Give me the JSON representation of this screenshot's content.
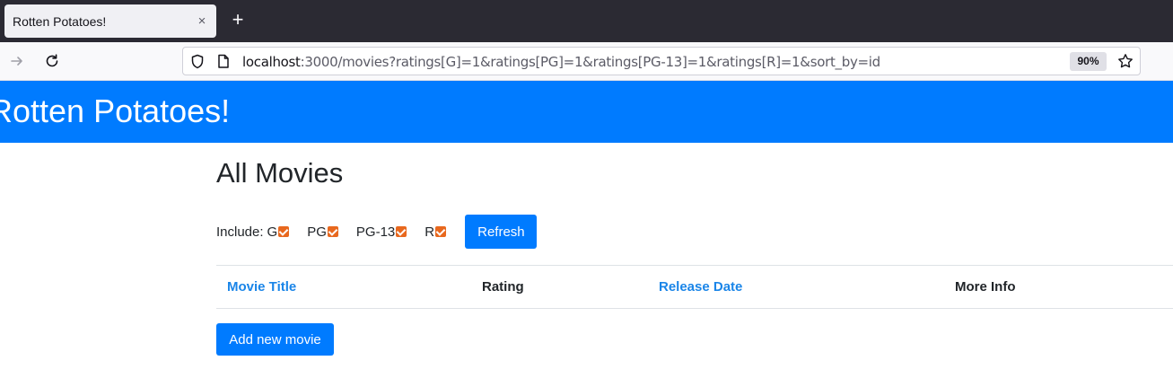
{
  "browser": {
    "tab_title": "Rotten Potatoes!",
    "tab_close": "×",
    "new_tab": "+",
    "url_host": "localhost",
    "url_rest": ":3000/movies?ratings[G]=1&ratings[PG]=1&ratings[PG-13]=1&ratings[R]=1&sort_by=id",
    "zoom": "90%"
  },
  "header": {
    "title": "Rotten Potatoes!"
  },
  "page": {
    "heading": "All Movies",
    "include_label": "Include:",
    "ratings": [
      {
        "label": "G",
        "checked": true
      },
      {
        "label": "PG",
        "checked": true
      },
      {
        "label": "PG-13",
        "checked": true
      },
      {
        "label": "R",
        "checked": true
      }
    ],
    "refresh_label": "Refresh",
    "table": {
      "columns": [
        {
          "label": "Movie Title",
          "link": true
        },
        {
          "label": "Rating",
          "link": false
        },
        {
          "label": "Release Date",
          "link": true
        },
        {
          "label": "More Info",
          "link": false
        }
      ],
      "rows": []
    },
    "add_label": "Add new movie"
  },
  "colors": {
    "brand": "#007bff",
    "link": "#1a85e8",
    "checkbox": "#e8681e"
  }
}
